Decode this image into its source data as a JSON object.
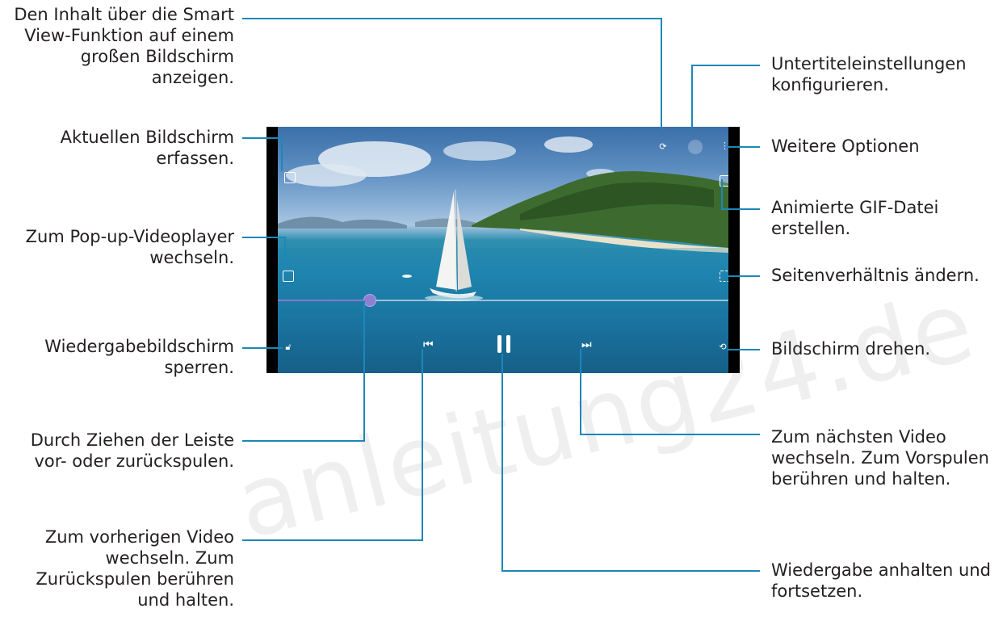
{
  "callouts": {
    "smart_view": "Den Inhalt über die Smart\nView-Funktion auf einem\ngroßen Bildschirm\nanzeigen.",
    "capture": "Aktuellen Bildschirm\nerfassen.",
    "popup": "Zum Pop-up-Videoplayer\nwechseln.",
    "lock": "Wiedergabebildschirm\nsperren.",
    "seek": "Durch Ziehen der Leiste\nvor- oder zurückspulen.",
    "prev": "Zum vorherigen Video\nwechseln. Zum\nZurückspulen berühren\nund halten.",
    "subtitles": "Untertiteleinstellungen\nkonfigurieren.",
    "more": "Weitere Optionen",
    "gif": "Animierte GIF-Datei\nerstellen.",
    "ratio": "Seitenverhältnis ändern.",
    "rotate": "Bildschirm drehen.",
    "next": "Zum nächsten Video\nwechseln. Zum Vorspulen\nberühren und halten.",
    "pause": "Wiedergabe anhalten und\nfortsetzen."
  },
  "player": {
    "progress": 0.2,
    "icons": [
      "smart-view-icon",
      "subtitle-icon",
      "more-options-icon",
      "capture-icon",
      "gif-icon",
      "popup-player-icon",
      "aspect-ratio-icon",
      "lock-icon",
      "rotate-icon",
      "previous-icon",
      "pause-icon",
      "next-icon"
    ]
  },
  "watermark": "anleitung24.de",
  "colors": {
    "callout_line": "#1b88b8",
    "seek_thumb": "#8f7fd1"
  }
}
